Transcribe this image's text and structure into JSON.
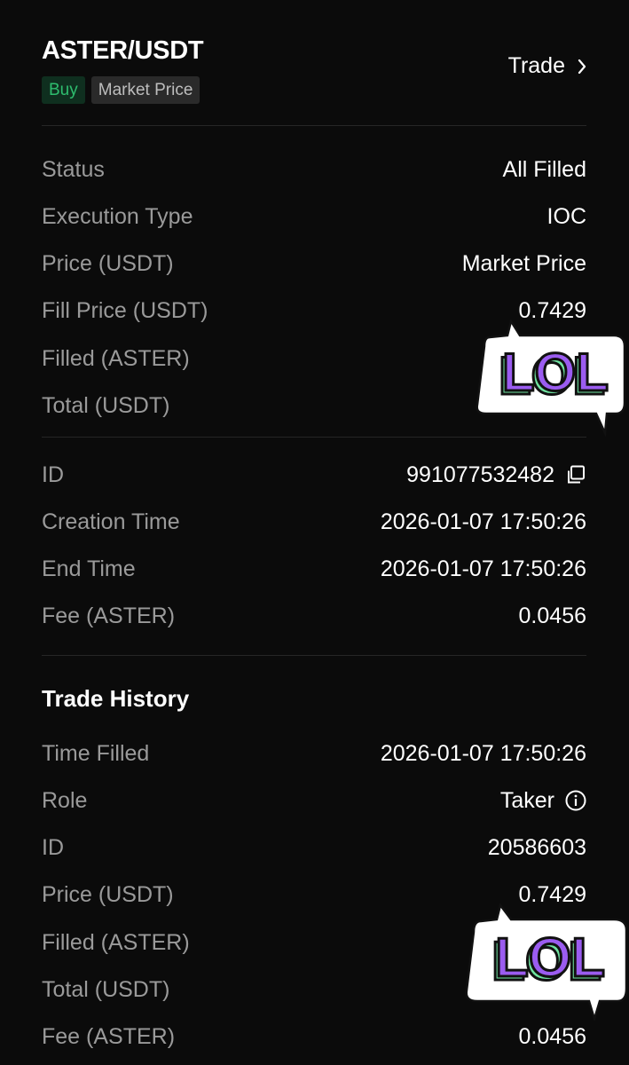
{
  "header": {
    "pair": "ASTER/USDT",
    "side_tag": "Buy",
    "type_tag": "Market Price",
    "trade_link": "Trade"
  },
  "order": [
    {
      "label": "Status",
      "value": "All Filled"
    },
    {
      "label": "Execution Type",
      "value": "IOC"
    },
    {
      "label": "Price (USDT)",
      "value": "Market Price"
    },
    {
      "label": "Fill Price (USDT)",
      "value": "0.7429"
    },
    {
      "label": "Filled (ASTER)",
      "value": ""
    },
    {
      "label": "Total (USDT)",
      "value": ""
    }
  ],
  "details": [
    {
      "label": "ID",
      "value": "991077532482"
    },
    {
      "label": "Creation Time",
      "value": "2026-01-07 17:50:26"
    },
    {
      "label": "End Time",
      "value": "2026-01-07 17:50:26"
    },
    {
      "label": "Fee (ASTER)",
      "value": "0.0456"
    }
  ],
  "trade_history": {
    "title": "Trade History",
    "rows": [
      {
        "label": "Time Filled",
        "value": "2026-01-07 17:50:26"
      },
      {
        "label": "Role",
        "value": "Taker"
      },
      {
        "label": "ID",
        "value": "20586603"
      },
      {
        "label": "Price (USDT)",
        "value": "0.7429"
      },
      {
        "label": "Filled (ASTER)",
        "value": ""
      },
      {
        "label": "Total (USDT)",
        "value": ""
      },
      {
        "label": "Fee (ASTER)",
        "value": "0.0456"
      }
    ]
  },
  "stickers": {
    "text": "LOL",
    "fill": "#9b5cf0",
    "accent": "#6fe3a0"
  },
  "colors": {
    "background": "#0b0b0b",
    "buy_green": "#2ebd6e",
    "label_gray": "#9a9a9a"
  }
}
